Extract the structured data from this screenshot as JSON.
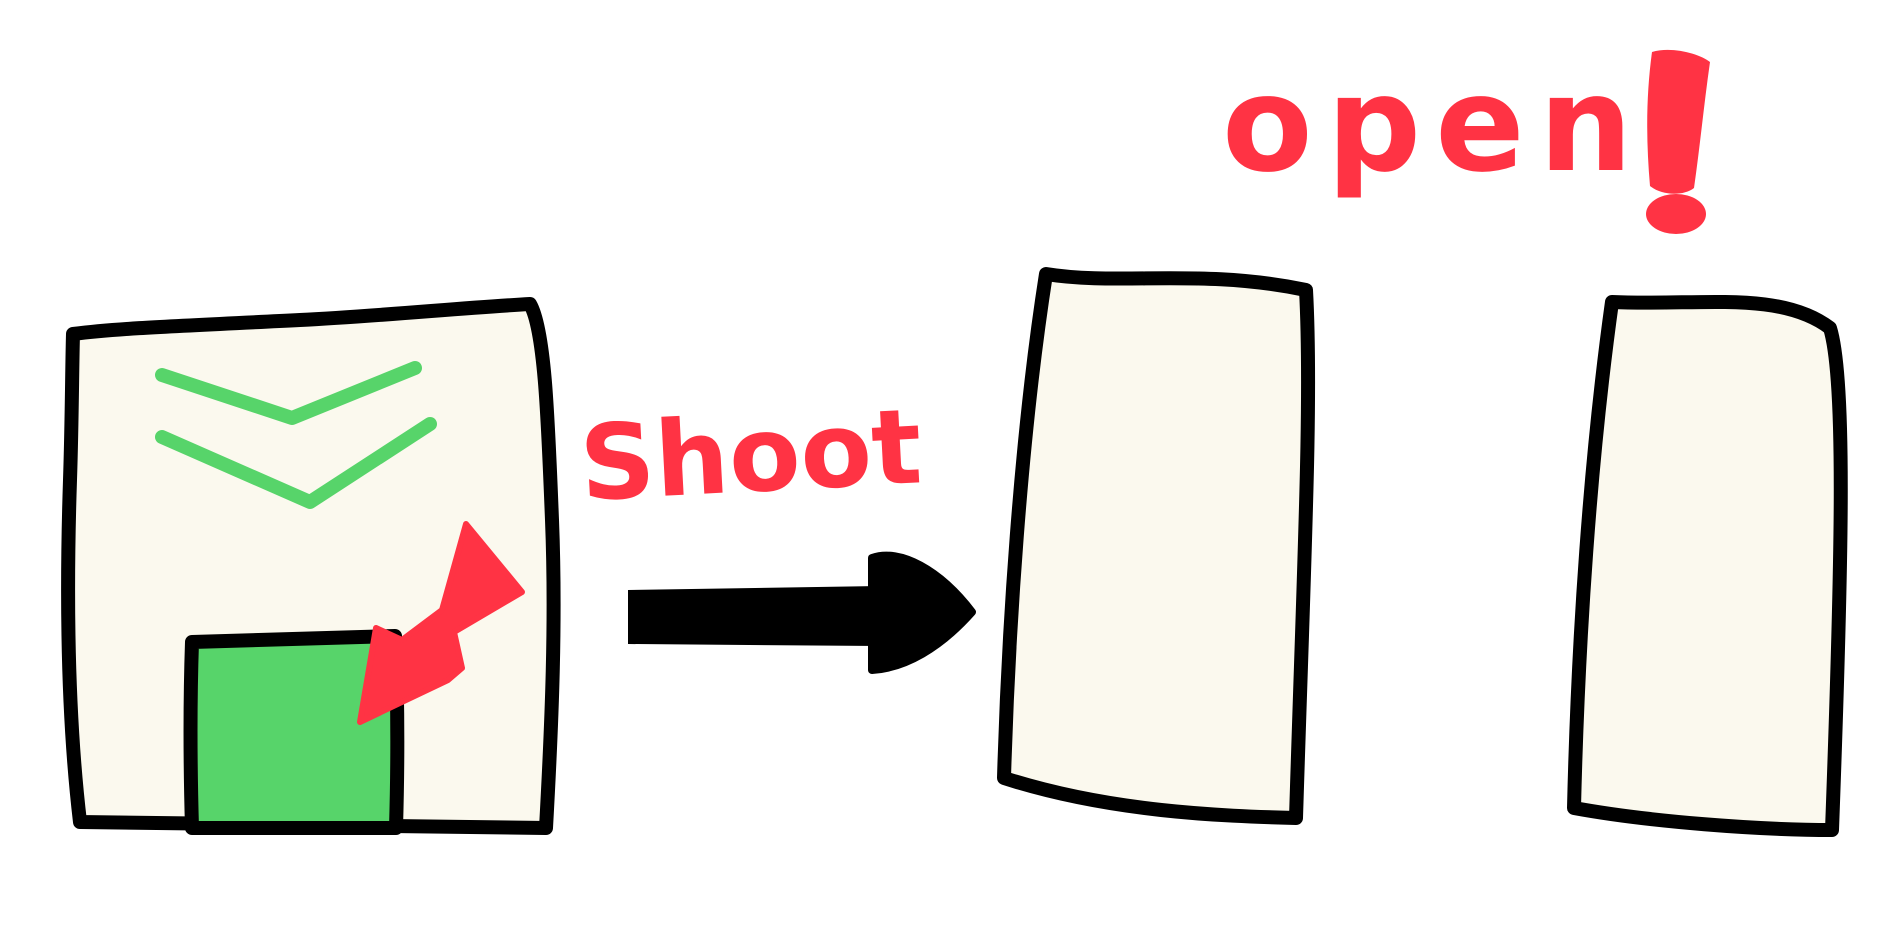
{
  "labels": {
    "shoot": "Shoot",
    "open": "open"
  },
  "icons": {
    "target": "green-target-square",
    "hit_marker": "red-arrow-icon",
    "chevrons": "green-chevron-marks",
    "transition": "black-arrow-icon",
    "exclamation": "red-exclamation-icon"
  },
  "colors": {
    "background": "#ffffff",
    "panel_fill": "#fbf9ee",
    "outline": "#000000",
    "accent_red": "#ff3344",
    "accent_green": "#57d46a"
  }
}
